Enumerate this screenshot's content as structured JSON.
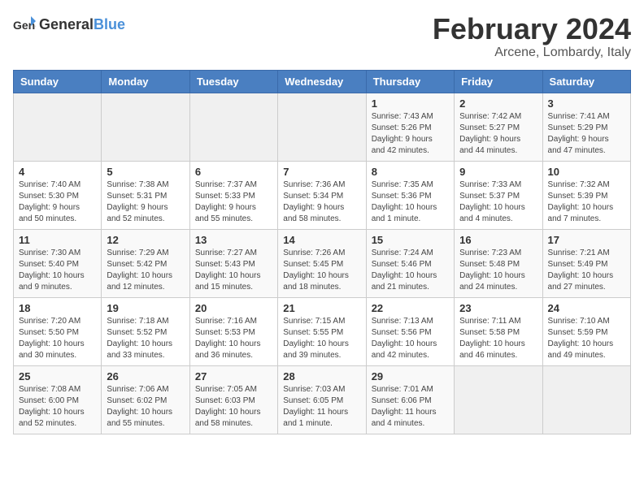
{
  "header": {
    "logo_general": "General",
    "logo_blue": "Blue",
    "month_title": "February 2024",
    "location": "Arcene, Lombardy, Italy"
  },
  "weekdays": [
    "Sunday",
    "Monday",
    "Tuesday",
    "Wednesday",
    "Thursday",
    "Friday",
    "Saturday"
  ],
  "weeks": [
    [
      {
        "day": "",
        "info": ""
      },
      {
        "day": "",
        "info": ""
      },
      {
        "day": "",
        "info": ""
      },
      {
        "day": "",
        "info": ""
      },
      {
        "day": "1",
        "info": "Sunrise: 7:43 AM\nSunset: 5:26 PM\nDaylight: 9 hours\nand 42 minutes."
      },
      {
        "day": "2",
        "info": "Sunrise: 7:42 AM\nSunset: 5:27 PM\nDaylight: 9 hours\nand 44 minutes."
      },
      {
        "day": "3",
        "info": "Sunrise: 7:41 AM\nSunset: 5:29 PM\nDaylight: 9 hours\nand 47 minutes."
      }
    ],
    [
      {
        "day": "4",
        "info": "Sunrise: 7:40 AM\nSunset: 5:30 PM\nDaylight: 9 hours\nand 50 minutes."
      },
      {
        "day": "5",
        "info": "Sunrise: 7:38 AM\nSunset: 5:31 PM\nDaylight: 9 hours\nand 52 minutes."
      },
      {
        "day": "6",
        "info": "Sunrise: 7:37 AM\nSunset: 5:33 PM\nDaylight: 9 hours\nand 55 minutes."
      },
      {
        "day": "7",
        "info": "Sunrise: 7:36 AM\nSunset: 5:34 PM\nDaylight: 9 hours\nand 58 minutes."
      },
      {
        "day": "8",
        "info": "Sunrise: 7:35 AM\nSunset: 5:36 PM\nDaylight: 10 hours\nand 1 minute."
      },
      {
        "day": "9",
        "info": "Sunrise: 7:33 AM\nSunset: 5:37 PM\nDaylight: 10 hours\nand 4 minutes."
      },
      {
        "day": "10",
        "info": "Sunrise: 7:32 AM\nSunset: 5:39 PM\nDaylight: 10 hours\nand 7 minutes."
      }
    ],
    [
      {
        "day": "11",
        "info": "Sunrise: 7:30 AM\nSunset: 5:40 PM\nDaylight: 10 hours\nand 9 minutes."
      },
      {
        "day": "12",
        "info": "Sunrise: 7:29 AM\nSunset: 5:42 PM\nDaylight: 10 hours\nand 12 minutes."
      },
      {
        "day": "13",
        "info": "Sunrise: 7:27 AM\nSunset: 5:43 PM\nDaylight: 10 hours\nand 15 minutes."
      },
      {
        "day": "14",
        "info": "Sunrise: 7:26 AM\nSunset: 5:45 PM\nDaylight: 10 hours\nand 18 minutes."
      },
      {
        "day": "15",
        "info": "Sunrise: 7:24 AM\nSunset: 5:46 PM\nDaylight: 10 hours\nand 21 minutes."
      },
      {
        "day": "16",
        "info": "Sunrise: 7:23 AM\nSunset: 5:48 PM\nDaylight: 10 hours\nand 24 minutes."
      },
      {
        "day": "17",
        "info": "Sunrise: 7:21 AM\nSunset: 5:49 PM\nDaylight: 10 hours\nand 27 minutes."
      }
    ],
    [
      {
        "day": "18",
        "info": "Sunrise: 7:20 AM\nSunset: 5:50 PM\nDaylight: 10 hours\nand 30 minutes."
      },
      {
        "day": "19",
        "info": "Sunrise: 7:18 AM\nSunset: 5:52 PM\nDaylight: 10 hours\nand 33 minutes."
      },
      {
        "day": "20",
        "info": "Sunrise: 7:16 AM\nSunset: 5:53 PM\nDaylight: 10 hours\nand 36 minutes."
      },
      {
        "day": "21",
        "info": "Sunrise: 7:15 AM\nSunset: 5:55 PM\nDaylight: 10 hours\nand 39 minutes."
      },
      {
        "day": "22",
        "info": "Sunrise: 7:13 AM\nSunset: 5:56 PM\nDaylight: 10 hours\nand 42 minutes."
      },
      {
        "day": "23",
        "info": "Sunrise: 7:11 AM\nSunset: 5:58 PM\nDaylight: 10 hours\nand 46 minutes."
      },
      {
        "day": "24",
        "info": "Sunrise: 7:10 AM\nSunset: 5:59 PM\nDaylight: 10 hours\nand 49 minutes."
      }
    ],
    [
      {
        "day": "25",
        "info": "Sunrise: 7:08 AM\nSunset: 6:00 PM\nDaylight: 10 hours\nand 52 minutes."
      },
      {
        "day": "26",
        "info": "Sunrise: 7:06 AM\nSunset: 6:02 PM\nDaylight: 10 hours\nand 55 minutes."
      },
      {
        "day": "27",
        "info": "Sunrise: 7:05 AM\nSunset: 6:03 PM\nDaylight: 10 hours\nand 58 minutes."
      },
      {
        "day": "28",
        "info": "Sunrise: 7:03 AM\nSunset: 6:05 PM\nDaylight: 11 hours\nand 1 minute."
      },
      {
        "day": "29",
        "info": "Sunrise: 7:01 AM\nSunset: 6:06 PM\nDaylight: 11 hours\nand 4 minutes."
      },
      {
        "day": "",
        "info": ""
      },
      {
        "day": "",
        "info": ""
      }
    ]
  ]
}
